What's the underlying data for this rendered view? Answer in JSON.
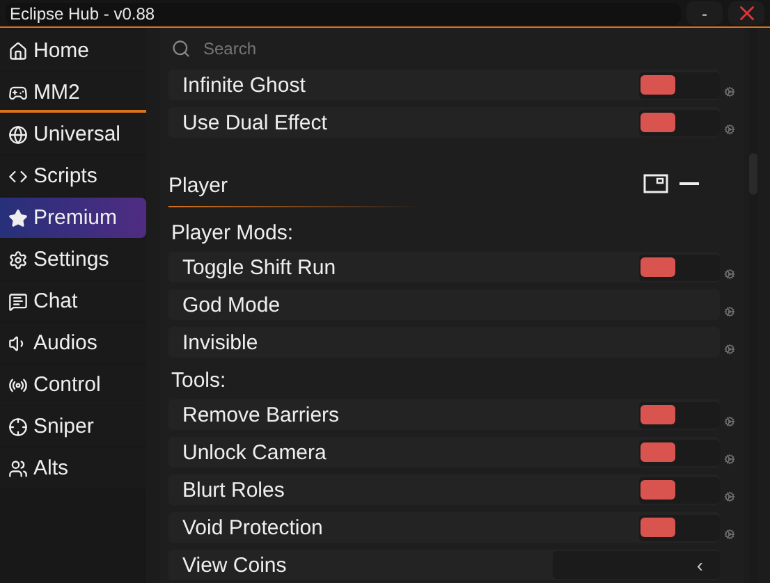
{
  "window": {
    "title": "Eclipse Hub - v0.88",
    "buttons": [
      "-"
    ]
  },
  "sidebar": {
    "items": [
      {
        "label": "Home",
        "selected": false,
        "underlined": false
      },
      {
        "label": "MM2",
        "selected": false,
        "underlined": true
      },
      {
        "label": "Universal",
        "selected": false,
        "underlined": false
      },
      {
        "label": "Scripts",
        "selected": false,
        "underlined": false
      },
      {
        "label": "Premium",
        "selected": true,
        "underlined": false
      },
      {
        "label": "Settings",
        "selected": false,
        "underlined": false
      },
      {
        "label": "Chat",
        "selected": false,
        "underlined": false
      },
      {
        "label": "Audios",
        "selected": false,
        "underlined": false
      },
      {
        "label": "Control",
        "selected": false,
        "underlined": false
      },
      {
        "label": "Sniper",
        "selected": false,
        "underlined": false
      },
      {
        "label": "Alts",
        "selected": false,
        "underlined": false
      }
    ]
  },
  "search": {
    "placeholder": "Search"
  },
  "items": [
    {
      "kind": "toggle",
      "label": "Infinite Ghost",
      "on": false
    },
    {
      "kind": "toggle",
      "label": "Use Dual Effect",
      "on": false
    },
    {
      "kind": "section",
      "label": "Player"
    },
    {
      "kind": "heading",
      "label": "Player Mods:"
    },
    {
      "kind": "toggle",
      "label": "Toggle Shift Run",
      "on": false
    },
    {
      "kind": "button",
      "label": "God Mode"
    },
    {
      "kind": "button",
      "label": "Invisible"
    },
    {
      "kind": "heading",
      "label": "Tools:"
    },
    {
      "kind": "toggle",
      "label": "Remove Barriers",
      "on": false
    },
    {
      "kind": "toggle",
      "label": "Unlock Camera",
      "on": false
    },
    {
      "kind": "toggle",
      "label": "Blurt Roles",
      "on": false
    },
    {
      "kind": "toggle",
      "label": "Void Protection",
      "on": false
    },
    {
      "kind": "dropdown",
      "label": "View Coins",
      "caret": "‹"
    }
  ]
}
